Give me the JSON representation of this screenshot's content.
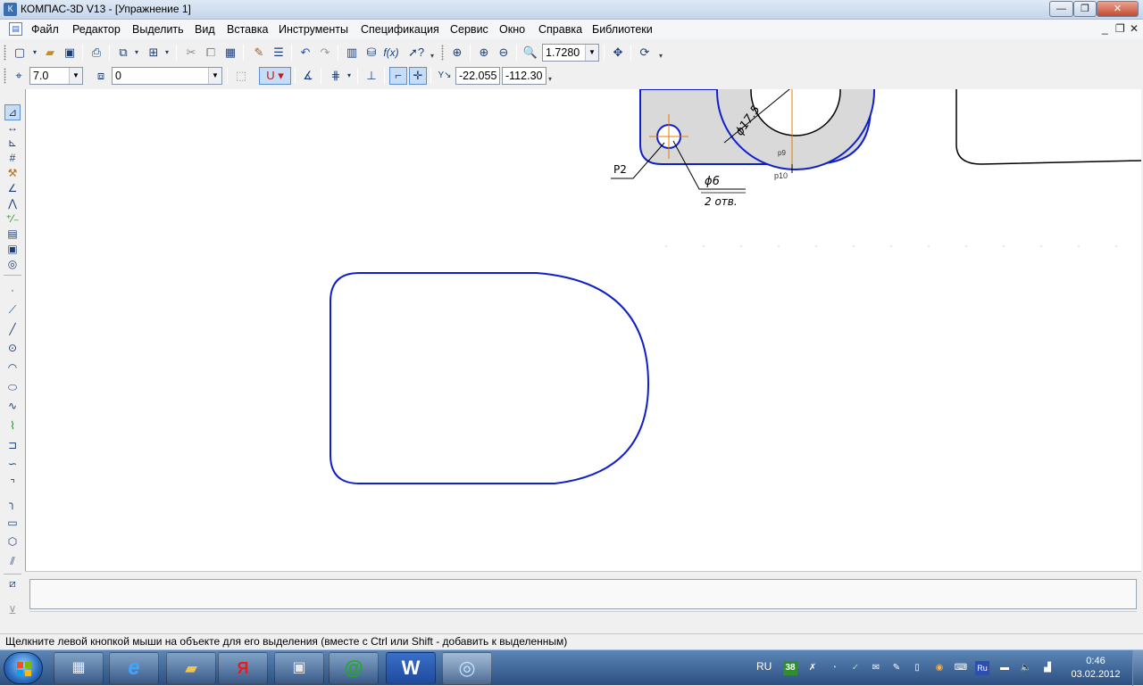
{
  "window": {
    "title": "КОМПАС-3D V13 - [Упражнение 1]",
    "minimize": "—",
    "maximize": "❐",
    "close": "✕"
  },
  "menu": {
    "items": [
      "Файл",
      "Редактор",
      "Выделить",
      "Вид",
      "Вставка",
      "Инструменты",
      "Спецификация",
      "Сервис",
      "Окно",
      "Справка",
      "Библиотеки"
    ],
    "mdi_minimize": "_",
    "mdi_restore": "❐",
    "mdi_close": "✕"
  },
  "standard_toolbar": {
    "zoom_value": "1.7280"
  },
  "current_state_toolbar": {
    "step_value": "7.0",
    "layer_value": "0",
    "coord_x": "-22.055",
    "coord_y": "-112.30"
  },
  "drawing": {
    "dim_diameter_large": "ϕ17.5",
    "label_p2": "P2",
    "dim_diameter_small": "ϕ6",
    "note_holes": "2 отв.",
    "label_p9": "p9",
    "label_p10": "p10",
    "colors": {
      "contour": "#1020c8",
      "axis": "#e08000",
      "fill": "#d9d9d9"
    }
  },
  "status": {
    "hint": "Щелкните левой кнопкой мыши на объекте для его выделения (вместе с Ctrl или Shift - добавить к выделенным)"
  },
  "taskbar": {
    "apps": [
      "calculator-icon",
      "internet-explorer-icon",
      "explorer-folder-icon",
      "yandex-icon",
      "media-icon",
      "mail-agent-icon",
      "word-icon",
      "kompas-icon"
    ],
    "word_label": "W",
    "yandex_label": "Я",
    "mail_label": "@",
    "tray_badge": "38",
    "tray_ru_badge": "Ru",
    "lang": "RU",
    "time": "0:46",
    "date": "03.02.2012"
  }
}
